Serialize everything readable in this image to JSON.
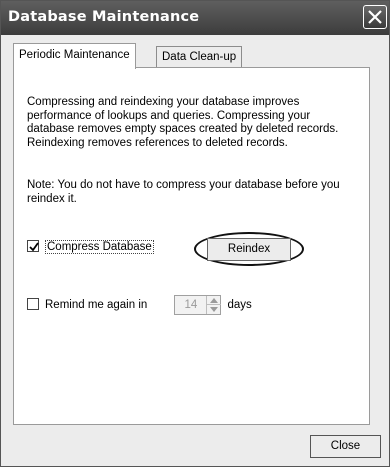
{
  "window": {
    "title": "Database Maintenance"
  },
  "tabs": [
    {
      "label": "Periodic Maintenance"
    },
    {
      "label": "Data Clean-up"
    }
  ],
  "description": "Compressing and reindexing your database improves performance of lookups and queries.  Compressing your database removes empty spaces created by deleted records. Reindexing removes references to deleted records.",
  "note": "Note: You do not have to compress your database before you reindex it.",
  "compress": {
    "label": "Compress Database",
    "checked": true
  },
  "reindex_button": "Reindex",
  "remind": {
    "label": "Remind me again in",
    "checked": false,
    "value": "14",
    "unit": "days"
  },
  "close_button": "Close"
}
